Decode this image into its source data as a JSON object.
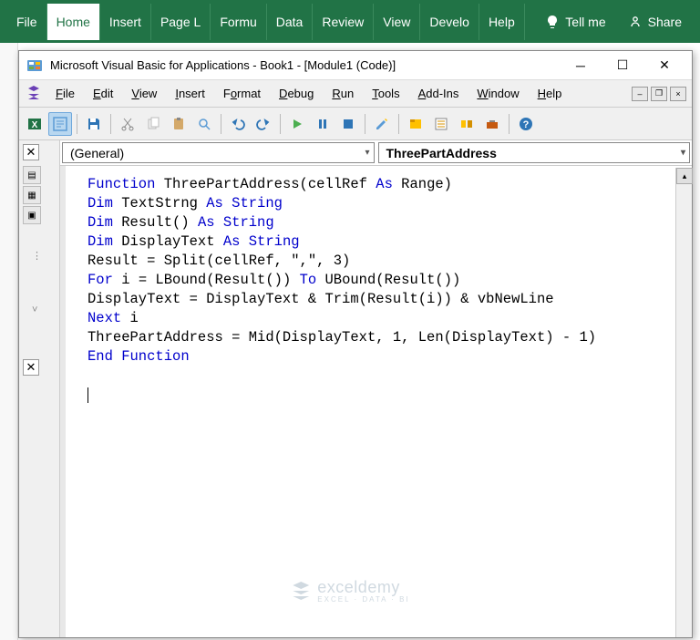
{
  "excel": {
    "tabs": [
      "File",
      "Home",
      "Insert",
      "Page L",
      "Formu",
      "Data",
      "Review",
      "View",
      "Develo",
      "Help"
    ],
    "active_tab": 1,
    "tellme": "Tell me",
    "share": "Share"
  },
  "vba": {
    "title": "Microsoft Visual Basic for Applications - Book1 - [Module1 (Code)]",
    "menus": [
      {
        "u": "F",
        "rest": "ile"
      },
      {
        "u": "E",
        "rest": "dit"
      },
      {
        "u": "V",
        "rest": "iew"
      },
      {
        "u": "I",
        "rest": "nsert"
      },
      {
        "u": "",
        "rest": "F",
        "u2": "o",
        "rest2": "rmat"
      },
      {
        "u": "D",
        "rest": "ebug"
      },
      {
        "u": "R",
        "rest": "un"
      },
      {
        "u": "T",
        "rest": "ools"
      },
      {
        "u": "A",
        "rest": "dd-Ins"
      },
      {
        "u": "W",
        "rest": "indow"
      },
      {
        "u": "H",
        "rest": "elp"
      }
    ],
    "object_dropdown": "(General)",
    "proc_dropdown": "ThreePartAddress",
    "code_tokens": [
      [
        {
          "t": "Function ",
          "k": 1
        },
        {
          "t": "ThreePartAddress(cellRef "
        },
        {
          "t": "As ",
          "k": 1
        },
        {
          "t": "Range)"
        }
      ],
      [
        {
          "t": "Dim ",
          "k": 1
        },
        {
          "t": "TextStrng "
        },
        {
          "t": "As String",
          "k": 1
        }
      ],
      [
        {
          "t": "Dim ",
          "k": 1
        },
        {
          "t": "Result() "
        },
        {
          "t": "As String",
          "k": 1
        }
      ],
      [
        {
          "t": "Dim ",
          "k": 1
        },
        {
          "t": "DisplayText "
        },
        {
          "t": "As String",
          "k": 1
        }
      ],
      [
        {
          "t": "Result = Split(cellRef, \",\", 3)"
        }
      ],
      [
        {
          "t": "For ",
          "k": 1
        },
        {
          "t": "i = LBound(Result()) "
        },
        {
          "t": "To ",
          "k": 1
        },
        {
          "t": "UBound(Result())"
        }
      ],
      [
        {
          "t": "DisplayText = DisplayText & Trim(Result(i)) & vbNewLine"
        }
      ],
      [
        {
          "t": "Next ",
          "k": 1
        },
        {
          "t": "i"
        }
      ],
      [
        {
          "t": "ThreePartAddress = Mid(DisplayText, 1, Len(DisplayText) - 1)"
        }
      ],
      [
        {
          "t": "End Function",
          "k": 1
        }
      ]
    ]
  },
  "watermark": {
    "brand": "exceldemy",
    "sub": "EXCEL · DATA · BI"
  },
  "colors": {
    "vb_keyword": "#0000cc",
    "excel_green": "#217346"
  }
}
